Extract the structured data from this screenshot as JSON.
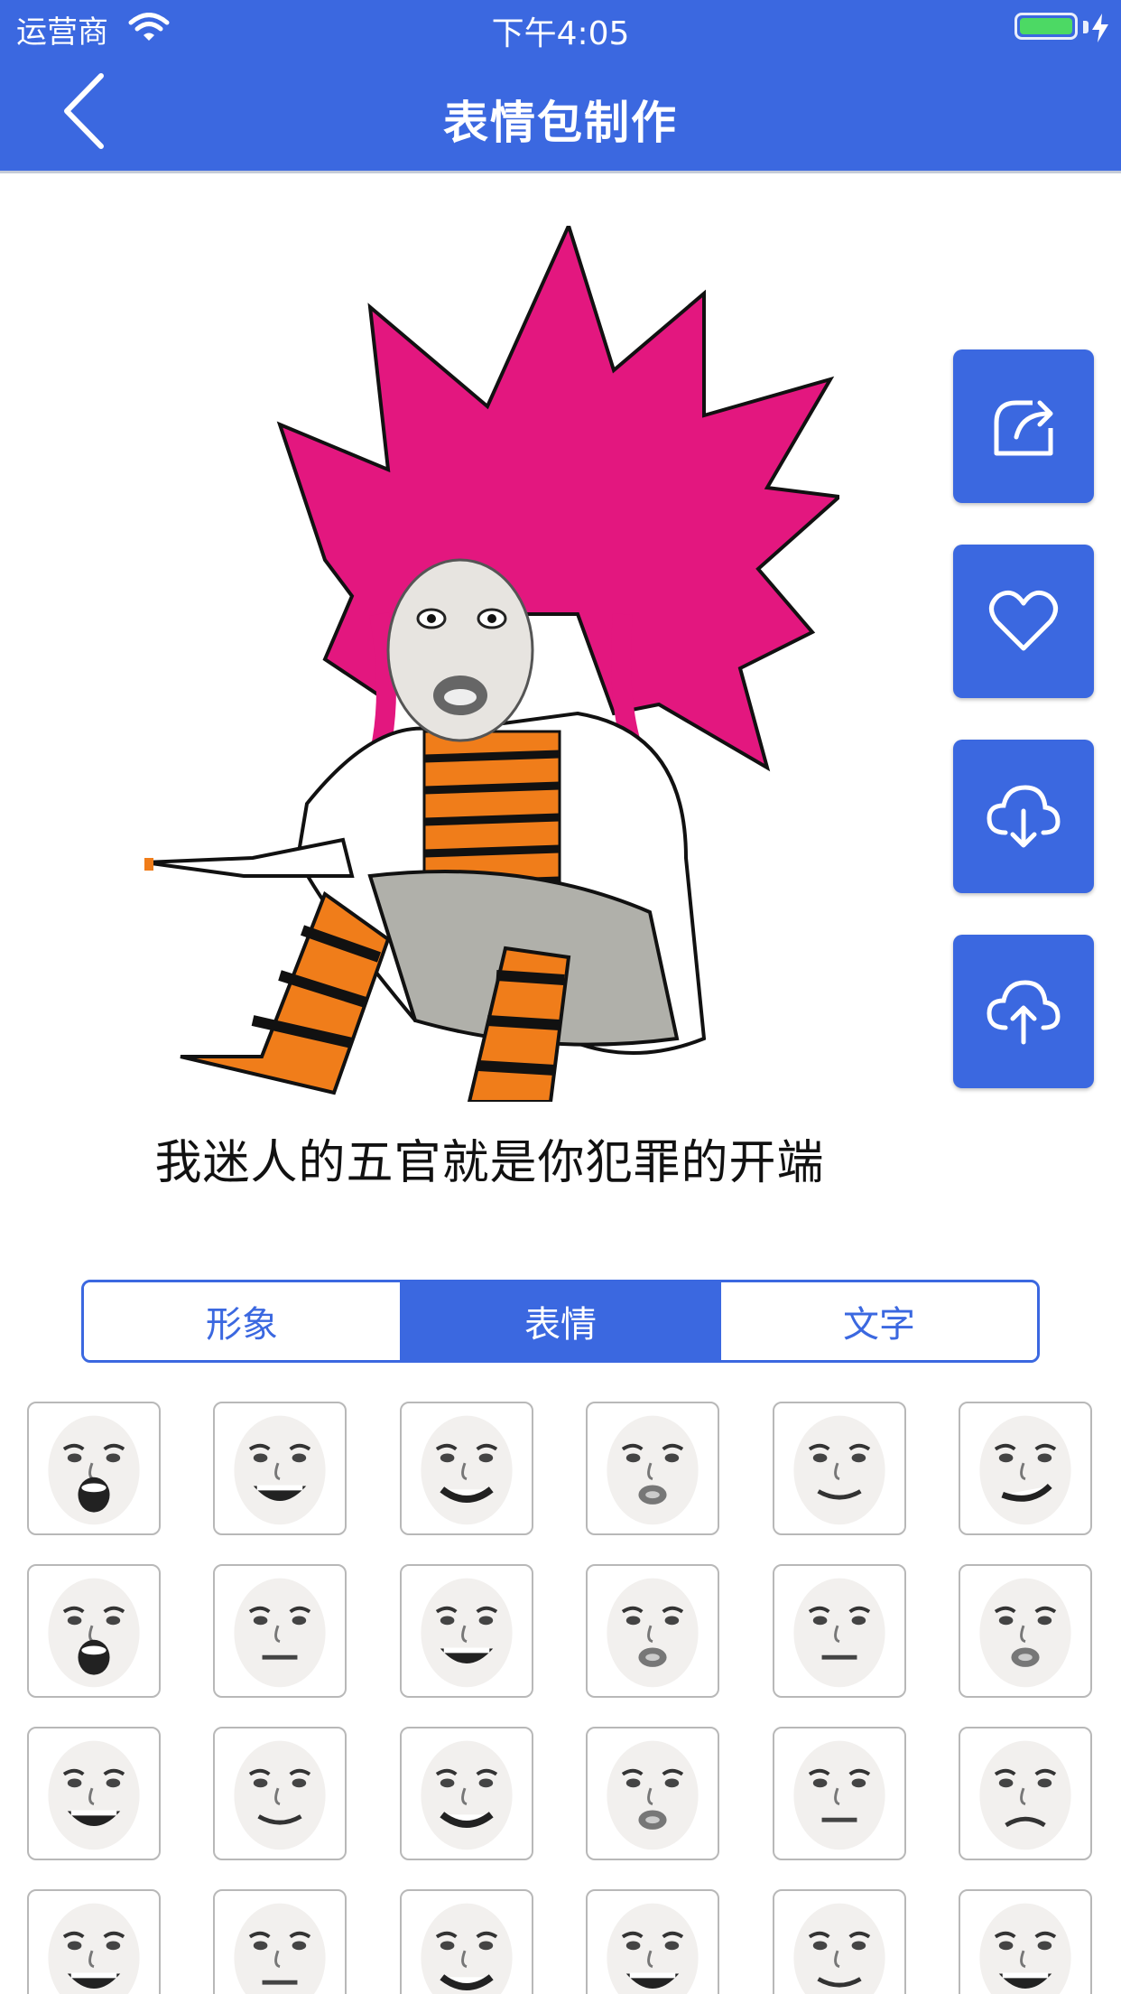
{
  "status_bar": {
    "carrier": "运营商",
    "time": "下午4:05"
  },
  "nav": {
    "title": "表情包制作"
  },
  "meme": {
    "caption": "我迷人的五官就是你犯罪的开端"
  },
  "actions": [
    {
      "name": "share-button",
      "icon": "share-icon"
    },
    {
      "name": "favorite-button",
      "icon": "heart-icon"
    },
    {
      "name": "download-button",
      "icon": "cloud-download-icon"
    },
    {
      "name": "upload-button",
      "icon": "cloud-upload-icon"
    }
  ],
  "tabs": [
    {
      "label": "形象",
      "active": false
    },
    {
      "label": "表情",
      "active": true
    },
    {
      "label": "文字",
      "active": false
    }
  ],
  "colors": {
    "accent": "#3b68e0",
    "hair": "#e3177f",
    "stripe": "#f07d1a"
  },
  "faces": [
    {
      "mouth": "shout"
    },
    {
      "mouth": "laugh"
    },
    {
      "mouth": "grin"
    },
    {
      "mouth": "pout"
    },
    {
      "mouth": "smile"
    },
    {
      "mouth": "smirk"
    },
    {
      "mouth": "shout"
    },
    {
      "mouth": "flat"
    },
    {
      "mouth": "laugh"
    },
    {
      "mouth": "pout"
    },
    {
      "mouth": "flat"
    },
    {
      "mouth": "pout"
    },
    {
      "mouth": "laugh"
    },
    {
      "mouth": "smile"
    },
    {
      "mouth": "grin"
    },
    {
      "mouth": "pout"
    },
    {
      "mouth": "flat"
    },
    {
      "mouth": "frown"
    },
    {
      "mouth": "laugh"
    },
    {
      "mouth": "flat"
    },
    {
      "mouth": "grin"
    },
    {
      "mouth": "laugh"
    },
    {
      "mouth": "smile"
    },
    {
      "mouth": "laugh"
    }
  ]
}
